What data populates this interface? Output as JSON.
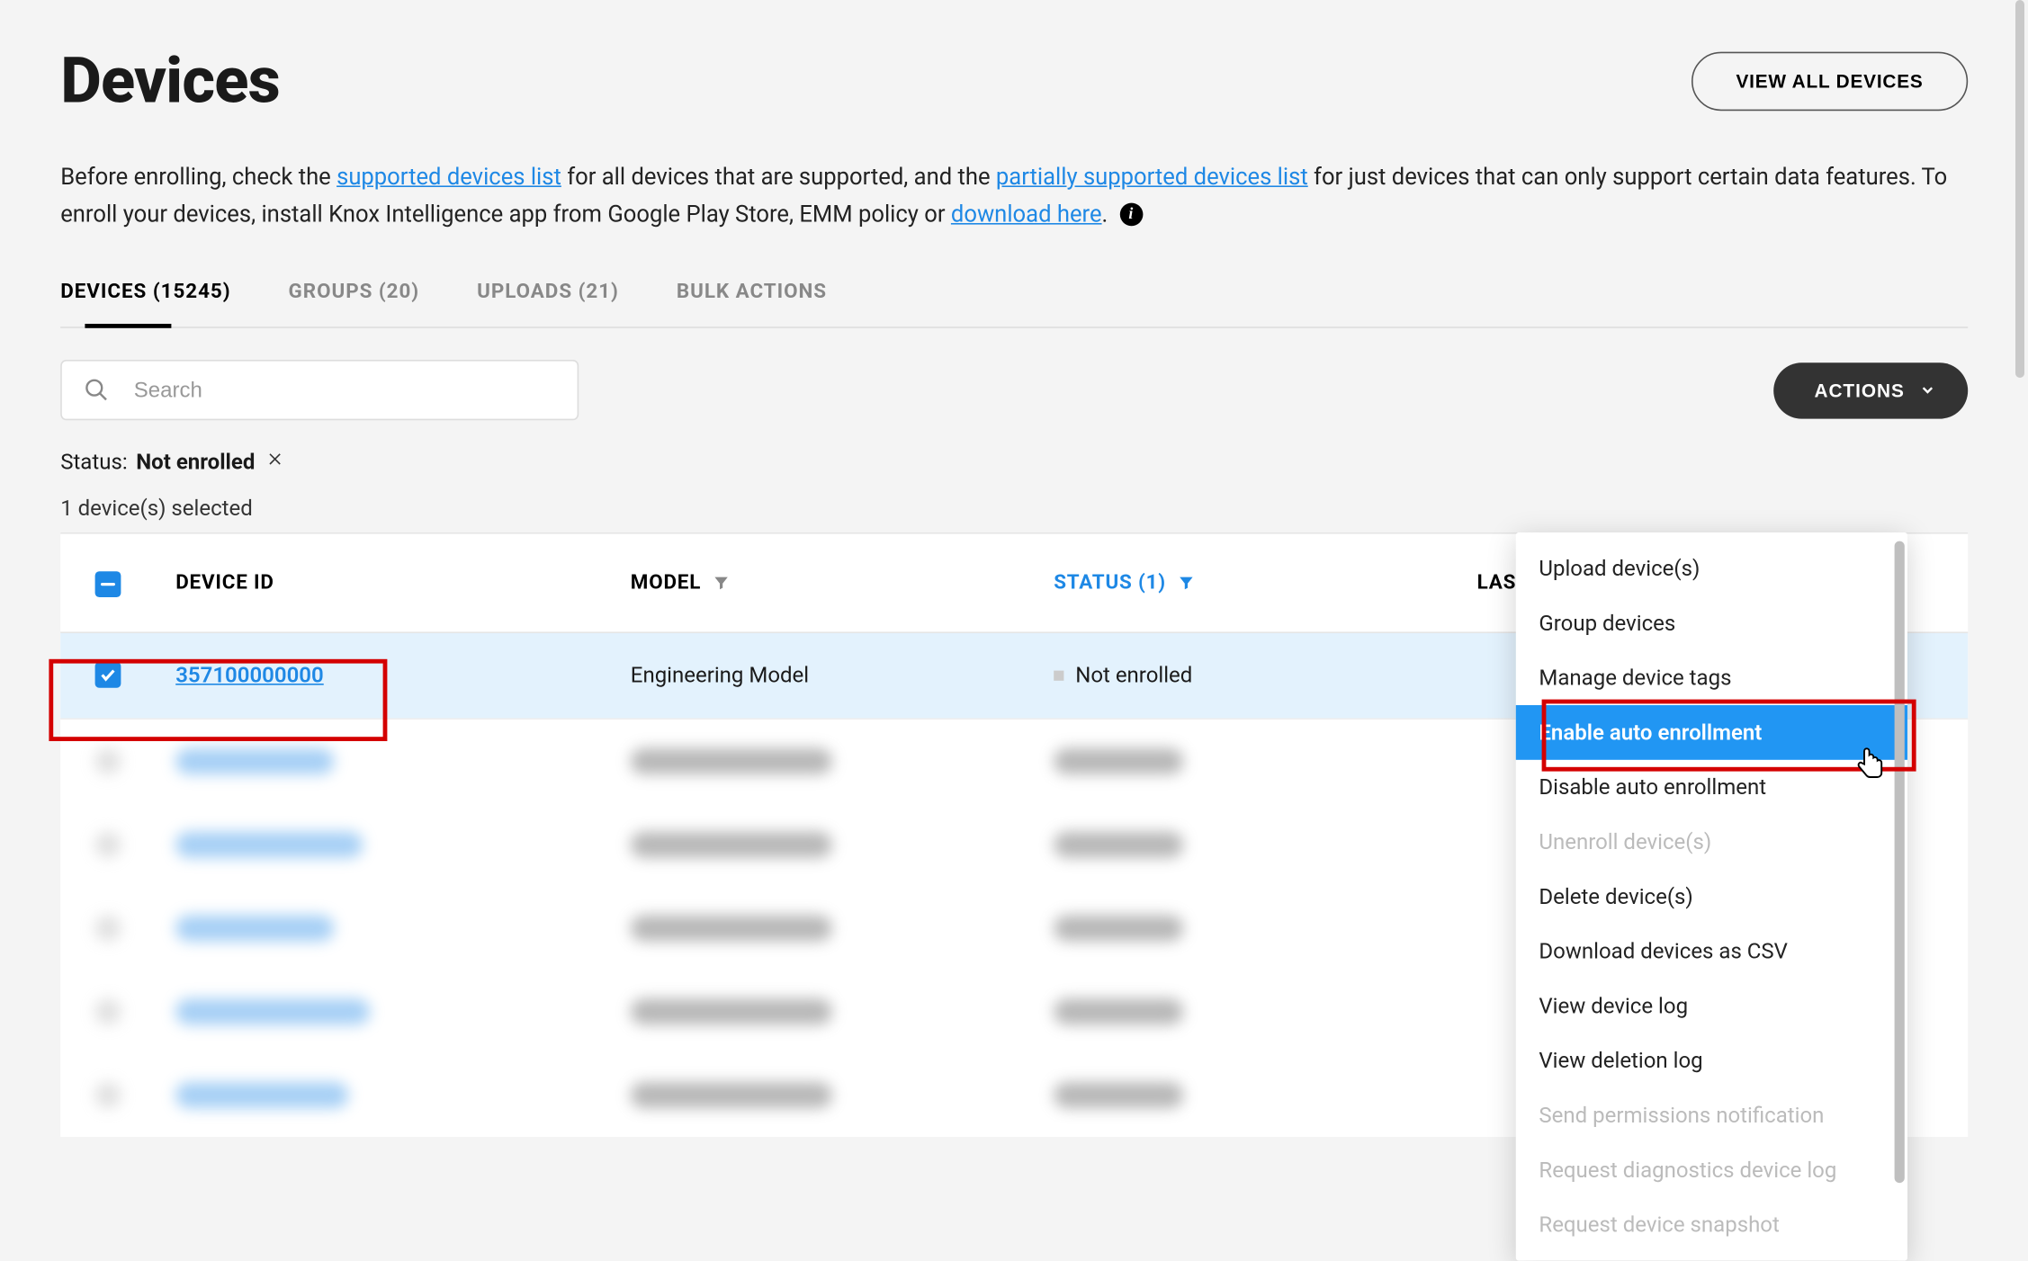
{
  "header": {
    "title": "Devices",
    "view_all": "VIEW ALL DEVICES"
  },
  "intro": {
    "before": "Before enrolling, check the ",
    "link1": "supported devices list",
    "mid1": " for all devices that are supported, and the ",
    "link2": "partially supported devices list",
    "mid2": " for just devices that can only support certain data features. To enroll your devices, install Knox Intelligence app from Google Play Store, EMM policy or ",
    "link3": "download here",
    "end": "."
  },
  "tabs": {
    "devices": "DEVICES (15245)",
    "groups": "GROUPS (20)",
    "uploads": "UPLOADS (21)",
    "bulk": "BULK ACTIONS"
  },
  "search": {
    "placeholder": "Search"
  },
  "actions_btn": "ACTIONS",
  "filter": {
    "label": "Status:",
    "value": "Not enrolled"
  },
  "selected_text": "1 device(s) selected",
  "columns": {
    "id": "DEVICE ID",
    "model": "MODEL",
    "status": "STATUS (1)",
    "last": "LAST SEEN"
  },
  "row1": {
    "id": "357100000000",
    "model": "Engineering Model",
    "status": "Not enrolled"
  },
  "dropdown": {
    "upload": "Upload device(s)",
    "group": "Group devices",
    "tags": "Manage device tags",
    "enable": "Enable auto enrollment",
    "disable": "Disable auto enrollment",
    "unenroll": "Unenroll device(s)",
    "delete": "Delete device(s)",
    "csv": "Download devices as CSV",
    "log": "View device log",
    "dellog": "View deletion log",
    "perms": "Send permissions notification",
    "diag": "Request diagnostics device log",
    "snap": "Request device snapshot"
  }
}
